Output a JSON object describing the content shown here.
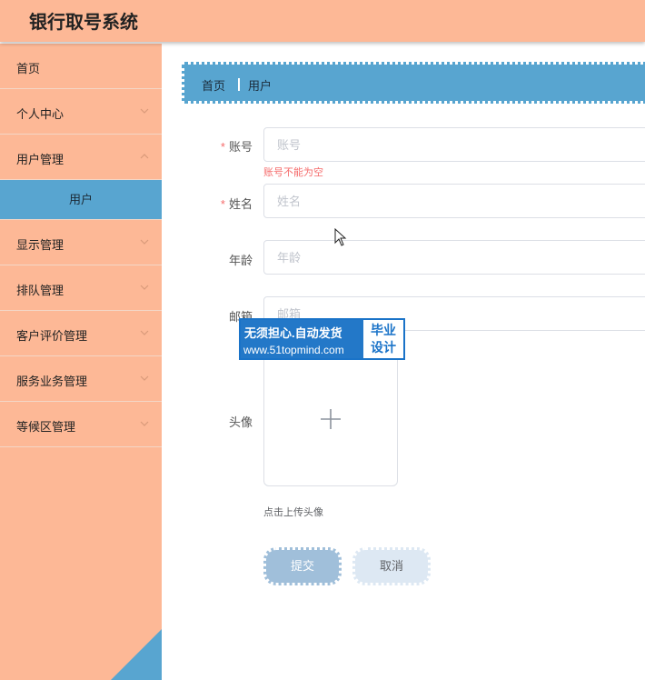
{
  "app": {
    "title": "银行取号系统"
  },
  "sidebar": {
    "items": [
      {
        "label": "首页",
        "has_arrow": false
      },
      {
        "label": "个人中心",
        "has_arrow": true
      },
      {
        "label": "用户管理",
        "has_arrow": true
      },
      {
        "label": "用户",
        "submenu": true
      },
      {
        "label": "显示管理",
        "has_arrow": true
      },
      {
        "label": "排队管理",
        "has_arrow": true
      },
      {
        "label": "客户评价管理",
        "has_arrow": true
      },
      {
        "label": "服务业务管理",
        "has_arrow": true
      },
      {
        "label": "等候区管理",
        "has_arrow": true
      }
    ]
  },
  "breadcrumb": {
    "home": "首页",
    "current": "用户"
  },
  "form": {
    "account": {
      "label": "账号",
      "placeholder": "账号",
      "value": "",
      "error": "账号不能为空",
      "required": true
    },
    "name": {
      "label": "姓名",
      "placeholder": "姓名",
      "value": "",
      "required": true
    },
    "age": {
      "label": "年龄",
      "placeholder": "年龄",
      "value": ""
    },
    "email": {
      "label": "邮箱",
      "placeholder": "邮箱",
      "value": ""
    },
    "avatar": {
      "label": "头像",
      "tip": "点击上传头像"
    },
    "submit_label": "提交",
    "cancel_label": "取消"
  },
  "watermark": {
    "line1": "无须担心.自动发货",
    "line2": "www.51topmind.com",
    "badge_line1": "毕业",
    "badge_line2": "设计"
  },
  "colors": {
    "header": "#fdb896",
    "accent": "#58a5d0",
    "error": "#f56c6c"
  }
}
